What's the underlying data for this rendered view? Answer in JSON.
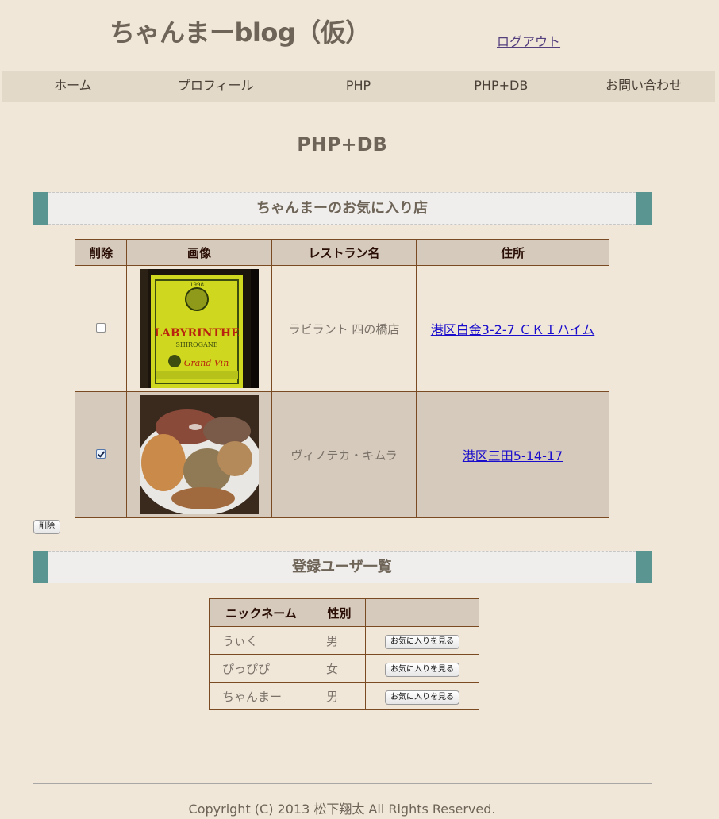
{
  "header": {
    "site_title": "ちゃんまーblog（仮）",
    "logout_label": "ログアウト"
  },
  "nav": {
    "items": [
      {
        "label": "ホーム"
      },
      {
        "label": "プロフィール"
      },
      {
        "label": "PHP"
      },
      {
        "label": "PHP+DB"
      },
      {
        "label": "お問い合わせ"
      }
    ]
  },
  "page_title": "PHP+DB",
  "favorites": {
    "section_title": "ちゃんまーのお気に入り店",
    "columns": [
      "削除",
      "画像",
      "レストラン名",
      "住所"
    ],
    "rows": [
      {
        "checked": false,
        "image_desc": "LABYRINTHE wine bottle label",
        "name": "ラビラント 四の橋店",
        "address": "港区白金3-2-7 ＣＫＩハイム"
      },
      {
        "checked": true,
        "image_desc": "dish with pâté and bread",
        "name": "ヴィノテカ・キムラ",
        "address": "港区三田5-14-17"
      }
    ],
    "label_text": {
      "year": "1998",
      "brand": "LABYRINTHE",
      "place": "SHIROGANE",
      "grand": "Grand Vin"
    },
    "delete_button": "削除"
  },
  "users": {
    "section_title": "登録ユーザ一覧",
    "columns": [
      "ニックネーム",
      "性別",
      ""
    ],
    "rows": [
      {
        "nickname": "うぃく",
        "gender": "男",
        "button": "お気に入りを見る"
      },
      {
        "nickname": "ぴっぴぴ",
        "gender": "女",
        "button": "お気に入りを見る"
      },
      {
        "nickname": "ちゃんまー",
        "gender": "男",
        "button": "お気に入りを見る"
      }
    ]
  },
  "footer": {
    "copyright": "Copyright (C) 2013 松下翔太 All Rights Reserved."
  },
  "colors": {
    "background": "#f0e7d9",
    "nav_background": "#e3d9c9",
    "section_accent": "#5b9592",
    "table_border": "#7a4a22",
    "table_header": "#d5cabb",
    "link": "#1a0dcc"
  }
}
